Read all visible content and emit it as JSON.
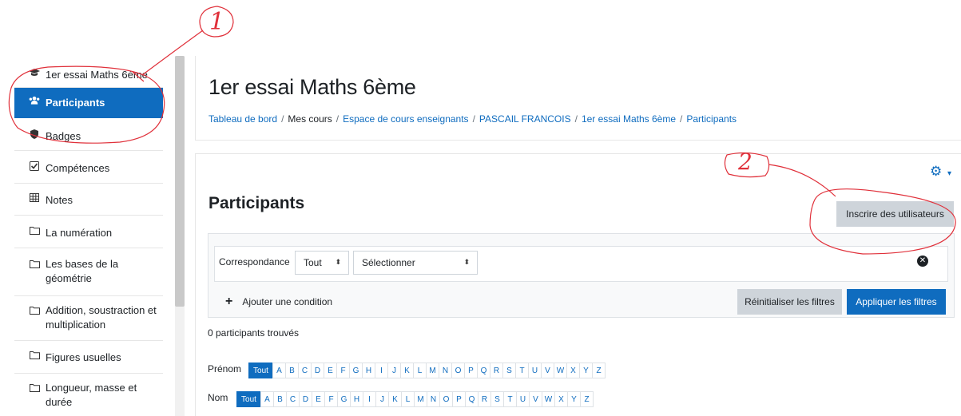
{
  "sidebar": {
    "items": [
      {
        "label": "1er essai Maths 6ème",
        "icon": "graduation-cap-icon",
        "glyph": "🎓"
      },
      {
        "label": "Participants",
        "icon": "users-icon",
        "glyph": "👥",
        "active": true
      },
      {
        "label": "Badges",
        "icon": "shield-icon",
        "glyph": "⛊"
      },
      {
        "label": "Compétences",
        "icon": "checkbox-icon",
        "glyph": "☑"
      },
      {
        "label": "Notes",
        "icon": "table-icon",
        "glyph": "▦"
      },
      {
        "label": "La numération",
        "icon": "folder-icon",
        "glyph": "🗀"
      },
      {
        "label": "Les bases de la géométrie",
        "icon": "folder-icon",
        "glyph": "🗀"
      },
      {
        "label": "Addition, soustraction et multiplication",
        "icon": "folder-icon",
        "glyph": "🗀"
      },
      {
        "label": "Figures usuelles",
        "icon": "folder-icon",
        "glyph": "🗀"
      },
      {
        "label": "Longueur, masse et durée",
        "icon": "folder-icon",
        "glyph": "🗀"
      }
    ]
  },
  "header": {
    "course_title": "1er essai Maths 6ème",
    "breadcrumb": [
      {
        "label": "Tableau de bord",
        "link": true
      },
      {
        "label": "Mes cours",
        "link": false
      },
      {
        "label": "Espace de cours enseignants",
        "link": true
      },
      {
        "label": "PASCAIL FRANCOIS",
        "link": true
      },
      {
        "label": "1er essai Maths 6ème",
        "link": true
      },
      {
        "label": "Participants",
        "link": true
      }
    ],
    "separator": "/"
  },
  "main": {
    "title": "Participants",
    "enrol_button": "Inscrire des utilisateurs",
    "filter": {
      "match_label": "Correspondance",
      "match_value": "Tout",
      "type_value": "Sélectionner",
      "add_condition": "Ajouter une condition",
      "reset_button": "Réinitialiser les filtres",
      "apply_button": "Appliquer les filtres"
    },
    "found_text": "0 participants trouvés",
    "firstname_label": "Prénom",
    "lastname_label": "Nom",
    "all_label": "Tout",
    "letters": [
      "A",
      "B",
      "C",
      "D",
      "E",
      "F",
      "G",
      "H",
      "I",
      "J",
      "K",
      "L",
      "M",
      "N",
      "O",
      "P",
      "Q",
      "R",
      "S",
      "T",
      "U",
      "V",
      "W",
      "X",
      "Y",
      "Z"
    ]
  },
  "annotations": {
    "one": "1",
    "two": "2"
  },
  "colors": {
    "accent": "#0f6cbf",
    "annotation": "#e0303a"
  }
}
